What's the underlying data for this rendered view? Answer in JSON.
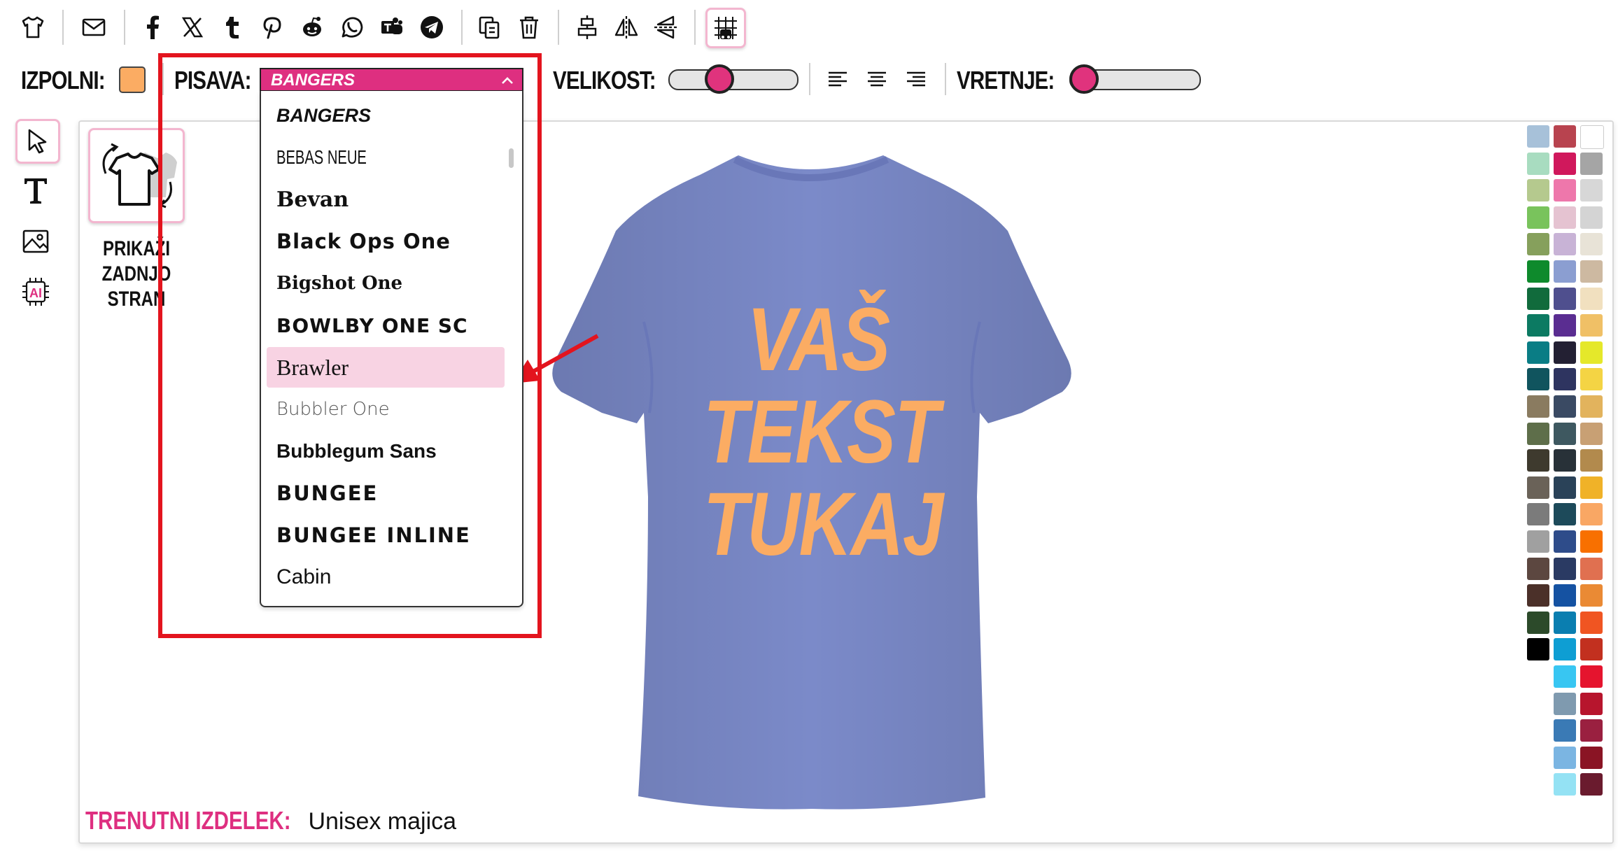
{
  "toolbar": {
    "icons": [
      "tshirt-icon",
      "envelope-icon",
      "facebook-icon",
      "x-icon",
      "tumblr-icon",
      "pinterest-icon",
      "reddit-icon",
      "whatsapp-icon",
      "teams-icon",
      "telegram-icon",
      "copy-icon",
      "trash-icon",
      "align-center-vertical-icon",
      "flip-horizontal-icon",
      "flip-vertical-icon",
      "grid-snap-icon"
    ]
  },
  "properties": {
    "fill_label": "IZPOLNI:",
    "fill_color": "#fbac63",
    "font_label": "PISAVA:",
    "font_selected": "BANGERS",
    "size_label": "VELIKOST:",
    "size_value": 0.15,
    "rotation_label": "VRETNJE:",
    "rotation_value": 0.0
  },
  "font_options": [
    {
      "label": "BANGERS",
      "style": "bangers"
    },
    {
      "label": "BEBAS NEUE",
      "style": "bebas"
    },
    {
      "label": "Bevan",
      "style": "bevan"
    },
    {
      "label": "Black Ops One",
      "style": "blackops"
    },
    {
      "label": "Bigshot One",
      "style": "bigshot"
    },
    {
      "label": "BOWLBY ONE SC",
      "style": "bowlby"
    },
    {
      "label": "Brawler",
      "style": "brawler",
      "highlighted": true
    },
    {
      "label": "Bubbler One",
      "style": "bubbler"
    },
    {
      "label": "Bubblegum Sans",
      "style": "bubblegum"
    },
    {
      "label": "BUNGEE",
      "style": "bungee"
    },
    {
      "label": "BUNGEE INLINE",
      "style": "bungeeinline"
    },
    {
      "label": "Cabin",
      "style": "cabin"
    }
  ],
  "back_side": {
    "label_lines": [
      "PRIKAŽI",
      "ZADNJO",
      "STRAN"
    ]
  },
  "design_text_lines": [
    "VAŠ",
    "TEKST",
    "TUKAJ"
  ],
  "tshirt_color": "#7b8ac9",
  "footer": {
    "label": "TRENUTNI IZDELEK:",
    "product": "Unisex majica"
  },
  "accent_color": "#de2f80",
  "palette_left": [
    "#a7c1d9",
    "#a8dcc0",
    "#b5c98e",
    "#79c35c",
    "#86a05c",
    "#0e8a2c",
    "#116b3c",
    "#0c7a62",
    "#0a7d85",
    "#10545e",
    "#8a7b60",
    "#5e6e4a",
    "#3e3a2e",
    "#6a6258",
    "#7b7b7b",
    "#a0a0a0",
    "#5c4740",
    "#4b3029",
    "#2c4a2a",
    "#000000"
  ],
  "palette_mid": [
    "#b8434f",
    "#d0185c",
    "#ee77ab",
    "#e5c3d1",
    "#c8b3d6",
    "#8b9ed1",
    "#4f4f8e",
    "#5a2d91",
    "#232033",
    "#2e3460",
    "#3a4a63",
    "#3e5860",
    "#283138",
    "#2a4258",
    "#1d4a5a",
    "#2e4c8a",
    "#2a3a63",
    "#1552a2",
    "#0a7eb0",
    "#0e9ed3",
    "#38c6f2",
    "#7f9aaf",
    "#3a7ab5",
    "#7bb5e2",
    "#94e2f4"
  ],
  "palette_right": [
    "#ffffff",
    "#a5a5a5",
    "#d7d7d7",
    "#d4d4d4",
    "#e8e3d7",
    "#cdb9a1",
    "#f1e0bf",
    "#f0c066",
    "#e5e82a",
    "#f4d444",
    "#e2b35d",
    "#c8a074",
    "#b28a4d",
    "#f0b228",
    "#f9a764",
    "#f87000",
    "#e07050",
    "#ea8a34",
    "#f05522",
    "#c2301f",
    "#e5142e",
    "#b7152d",
    "#9a2040",
    "#8a1424",
    "#6a1b2e"
  ]
}
